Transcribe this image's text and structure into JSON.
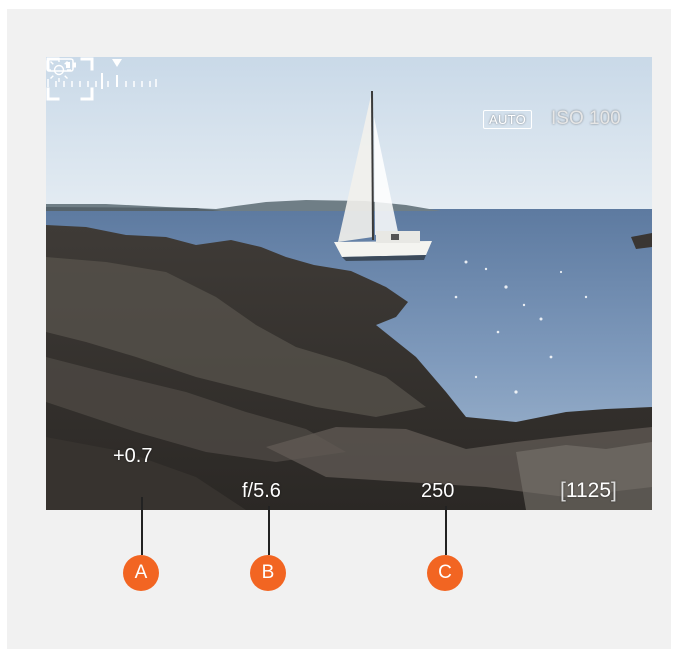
{
  "colors": {
    "panel_background": "#f1f1f1",
    "overlay_text": "#ffffff",
    "callout_badge": "#f26522",
    "callout_line": "#222222"
  },
  "viewfinder": {
    "exposure_mode_icon": "sun-icon",
    "battery_icon": "battery-icon",
    "mode_badge": "AUTO",
    "iso": "ISO 100",
    "focus_frame_icon": "focus-bracket-icon",
    "exposure_compensation": "+0.7",
    "exposure_scale_icon": "exposure-scale-icon",
    "aperture": "f/5.6",
    "shutter_speed": "250",
    "shots_remaining": {
      "open": "[",
      "value": "1125",
      "close": "]"
    }
  },
  "callouts": [
    "A",
    "B",
    "C"
  ]
}
